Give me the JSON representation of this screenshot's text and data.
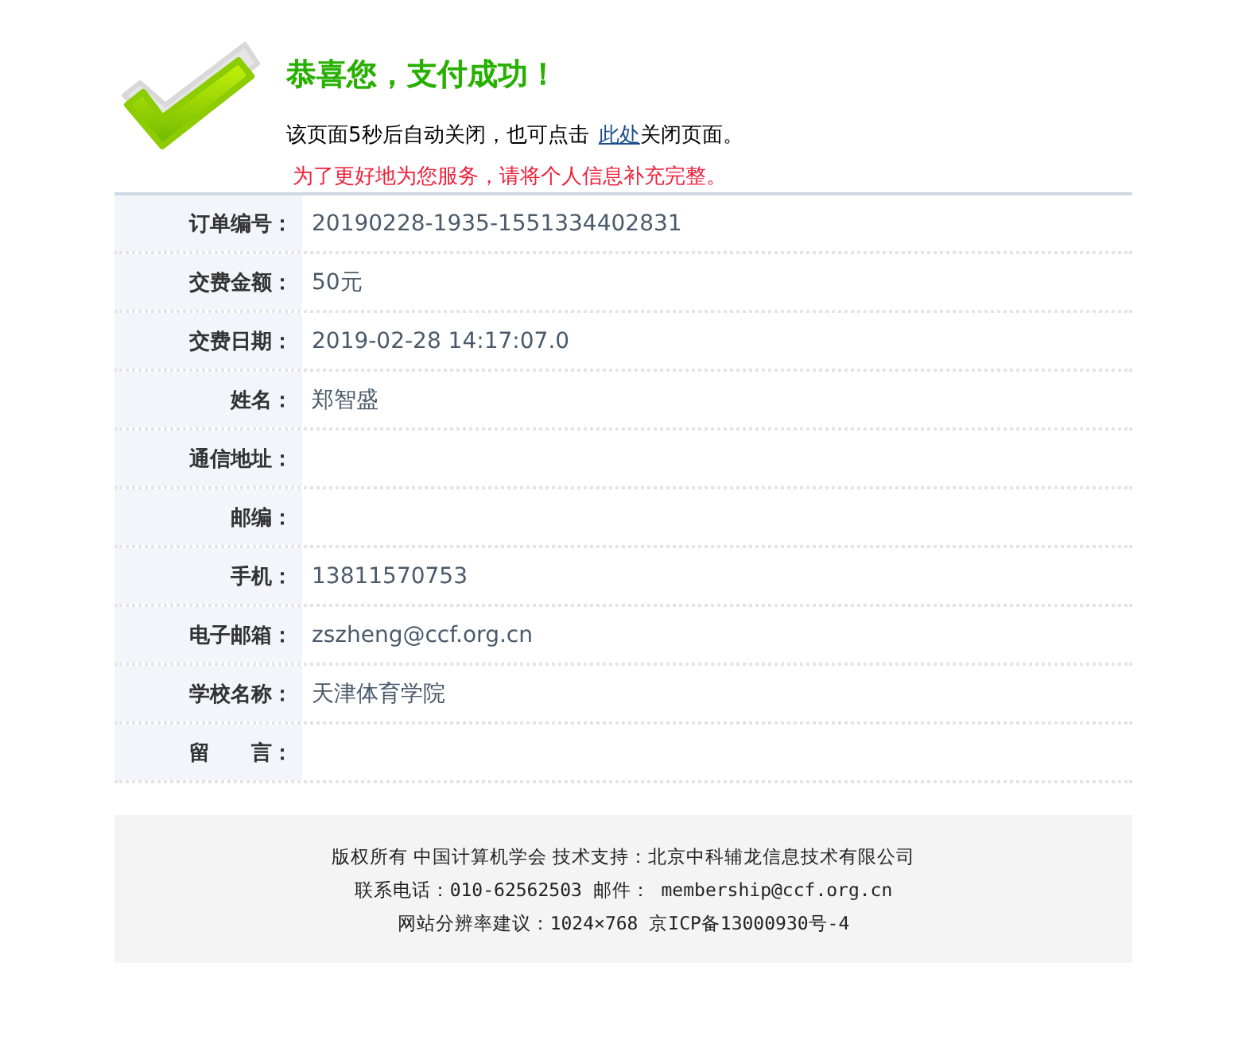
{
  "header": {
    "title": "恭喜您，支付成功！",
    "notice": {
      "before": "该页面5秒后自动关闭，也可点击 ",
      "link": "此处",
      "after": "关闭页面。"
    },
    "reminder": "为了更好地为您服务，请将个人信息补充完整。"
  },
  "rows": [
    {
      "label": "订单编号：",
      "value": "20190228-1935-1551334402831"
    },
    {
      "label": "交费金额：",
      "value": "50元"
    },
    {
      "label": "交费日期：",
      "value": "2019-02-28 14:17:07.0"
    },
    {
      "label": "姓名：",
      "value": "郑智盛"
    },
    {
      "label": "通信地址："
    },
    {
      "label": "邮编："
    },
    {
      "label": "手机：",
      "value": "13811570753"
    },
    {
      "label": "电子邮箱：",
      "value": "zszheng@ccf.org.cn"
    },
    {
      "label": "学校名称：",
      "value": "天津体育学院"
    },
    {
      "label": "留　　言："
    }
  ],
  "footer": [
    "版权所有 中国计算机学会 技术支持：北京中科辅龙信息技术有限公司",
    "联系电话：010-62562503 邮件： membership@ccf.org.cn",
    "网站分辨率建议：1024×768 京ICP备13000930号-4"
  ]
}
